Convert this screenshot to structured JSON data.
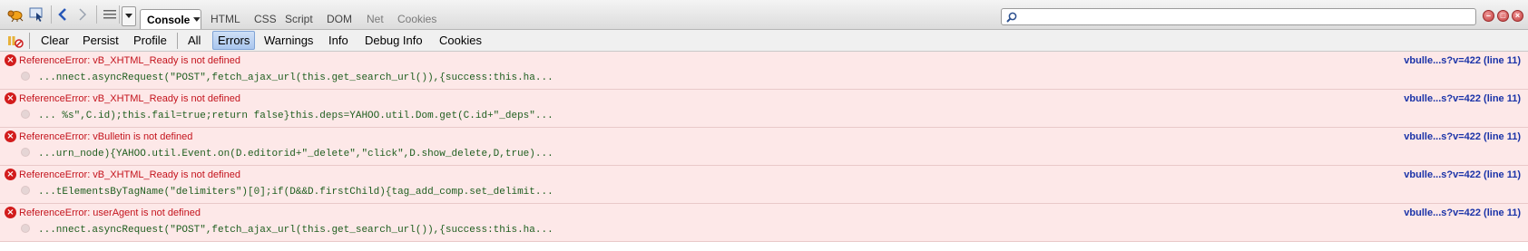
{
  "toolbar": {
    "console_label": "Console",
    "tabs": [
      "HTML",
      "CSS",
      "Script",
      "DOM",
      "Net",
      "Cookies"
    ],
    "search": {
      "value": "",
      "placeholder": ""
    }
  },
  "filterbar": {
    "clear": "Clear",
    "persist": "Persist",
    "profile": "Profile",
    "all": "All",
    "errors": "Errors",
    "warnings": "Warnings",
    "info": "Info",
    "debug_info": "Debug Info",
    "cookies": "Cookies"
  },
  "errors": [
    {
      "message": "ReferenceError: vB_XHTML_Ready is not defined",
      "source": "vbulle...s?v=422 (line 11)",
      "code": "...nnect.asyncRequest(\"POST\",fetch_ajax_url(this.get_search_url()),{success:this.ha..."
    },
    {
      "message": "ReferenceError: vB_XHTML_Ready is not defined",
      "source": "vbulle...s?v=422 (line 11)",
      "code": "... %s\",C.id);this.fail=true;return false}this.deps=YAHOO.util.Dom.get(C.id+\"_deps\"..."
    },
    {
      "message": "ReferenceError: vBulletin is not defined",
      "source": "vbulle...s?v=422 (line 11)",
      "code": "...urn_node){YAHOO.util.Event.on(D.editorid+\"_delete\",\"click\",D.show_delete,D,true)..."
    },
    {
      "message": "ReferenceError: vB_XHTML_Ready is not defined",
      "source": "vbulle...s?v=422 (line 11)",
      "code": "...tElementsByTagName(\"delimiters\")[0];if(D&&D.firstChild){tag_add_comp.set_delimit..."
    },
    {
      "message": "ReferenceError: userAgent is not defined",
      "source": "vbulle...s?v=422 (line 11)",
      "code": "...nnect.asyncRequest(\"POST\",fetch_ajax_url(this.get_search_url()),{success:this.ha..."
    }
  ]
}
